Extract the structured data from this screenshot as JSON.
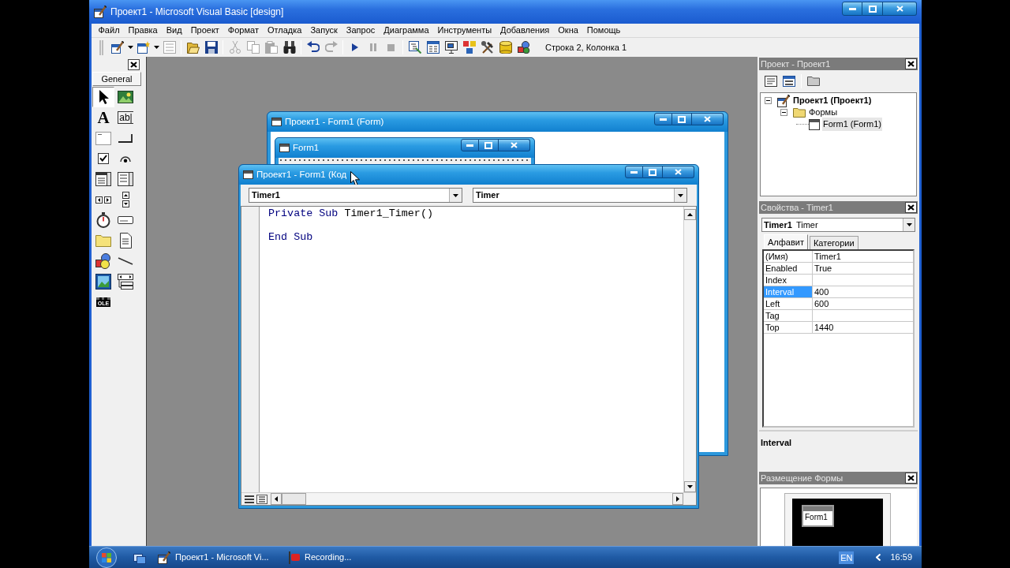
{
  "window": {
    "title": "Проект1 - Microsoft Visual Basic [design]"
  },
  "menu": [
    "Файл",
    "Правка",
    "Вид",
    "Проект",
    "Формат",
    "Отладка",
    "Запуск",
    "Запрос",
    "Диаграмма",
    "Инструменты",
    "Добавления",
    "Окна",
    "Помощь"
  ],
  "toolbar": {
    "groups": [
      [
        {
          "kind": "project",
          "disabled": false
        },
        {
          "kind": "form",
          "disabled": false
        },
        {
          "kind": "menu",
          "disabled": true
        }
      ],
      [
        {
          "kind": "open",
          "disabled": false
        },
        {
          "kind": "save",
          "disabled": false
        }
      ],
      [
        {
          "kind": "cut",
          "disabled": true
        },
        {
          "kind": "copy",
          "disabled": true
        },
        {
          "kind": "paste",
          "disabled": true
        },
        {
          "kind": "find",
          "disabled": false
        }
      ],
      [
        {
          "kind": "undo",
          "disabled": false
        },
        {
          "kind": "redo",
          "disabled": true
        }
      ],
      [
        {
          "kind": "run",
          "disabled": false
        },
        {
          "kind": "pause",
          "disabled": true
        },
        {
          "kind": "stop",
          "disabled": true
        }
      ],
      [
        {
          "kind": "explorer",
          "disabled": false
        },
        {
          "kind": "properties",
          "disabled": false
        },
        {
          "kind": "layout",
          "disabled": false
        },
        {
          "kind": "browser",
          "disabled": false
        },
        {
          "kind": "toolbox",
          "disabled": false
        },
        {
          "kind": "data",
          "disabled": false
        },
        {
          "kind": "components",
          "disabled": false
        }
      ]
    ],
    "status": "Строка 2, Колонка 1"
  },
  "toolbox": {
    "tab": "General",
    "tools": [
      {
        "kind": "pointer",
        "selected": true
      },
      {
        "kind": "picture",
        "selected": false
      },
      {
        "kind": "label",
        "glyph": "A",
        "selected": false
      },
      {
        "kind": "textbox",
        "glyph": "ab|",
        "selected": false
      },
      {
        "kind": "frame",
        "selected": false
      },
      {
        "kind": "button",
        "selected": false
      },
      {
        "kind": "checkbox",
        "selected": false
      },
      {
        "kind": "option",
        "selected": false
      },
      {
        "kind": "combo",
        "selected": false
      },
      {
        "kind": "list",
        "selected": false
      },
      {
        "kind": "hscroll",
        "selected": false
      },
      {
        "kind": "vscroll",
        "selected": false
      },
      {
        "kind": "timer",
        "selected": false
      },
      {
        "kind": "drive",
        "selected": false
      },
      {
        "kind": "folder",
        "selected": false
      },
      {
        "kind": "file",
        "selected": false
      },
      {
        "kind": "shape",
        "selected": false
      },
      {
        "kind": "line",
        "selected": false
      },
      {
        "kind": "image",
        "selected": false
      },
      {
        "kind": "data",
        "selected": false
      },
      {
        "kind": "ole",
        "glyph": "OLE",
        "selected": false
      }
    ]
  },
  "form_window": {
    "title": "Проект1 - Form1 (Form)",
    "form_title": "Form1"
  },
  "code_window": {
    "title": "Проект1 - Form1 (Код",
    "object": "Timer1",
    "procedure": "Timer",
    "lines": [
      {
        "kind": "code",
        "tokens": [
          {
            "kind": "keyword",
            "text": "Private Sub"
          },
          {
            "kind": "plain",
            "text": "Timer1_Timer()"
          }
        ]
      },
      {
        "kind": "blank"
      },
      {
        "kind": "code",
        "tokens": [
          {
            "kind": "keyword",
            "text": "End Sub"
          }
        ]
      }
    ]
  },
  "project_panel": {
    "title": "Проект - Проект1",
    "tree": [
      {
        "kind": "project",
        "label": "Проект1 (Проект1)",
        "expanded": true,
        "selected": false,
        "children": [
          {
            "kind": "folder",
            "label": "Формы",
            "expanded": true,
            "selected": false,
            "children": [
              {
                "kind": "form",
                "label": "Form1 (Form1)",
                "selected": true
              }
            ]
          }
        ]
      }
    ]
  },
  "properties_panel": {
    "title": "Свойства - Timer1",
    "object_name": "Timer1",
    "object_type": "Timer",
    "tabs": [
      {
        "label": "Алфавит",
        "selected": true
      },
      {
        "label": "Категории",
        "selected": false
      }
    ],
    "rows": [
      {
        "name": "(Имя)",
        "value": "Timer1",
        "selected": false
      },
      {
        "name": "Enabled",
        "value": "True",
        "selected": false
      },
      {
        "name": "Index",
        "selected": false
      },
      {
        "name": "Interval",
        "value": "400",
        "selected": true
      },
      {
        "name": "Left",
        "value": "600",
        "selected": false
      },
      {
        "name": "Tag",
        "selected": false
      },
      {
        "name": "Top",
        "value": "1440",
        "selected": false
      }
    ],
    "description": "Interval"
  },
  "layout_panel": {
    "title": "Размещение Формы",
    "form_label": "Form1"
  },
  "taskbar": {
    "tasks": [
      {
        "kind": "vb",
        "label": "Проект1 - Microsoft Vi..."
      },
      {
        "kind": "recorder",
        "label": "Recording..."
      }
    ],
    "language": "EN",
    "time": "16:59"
  }
}
